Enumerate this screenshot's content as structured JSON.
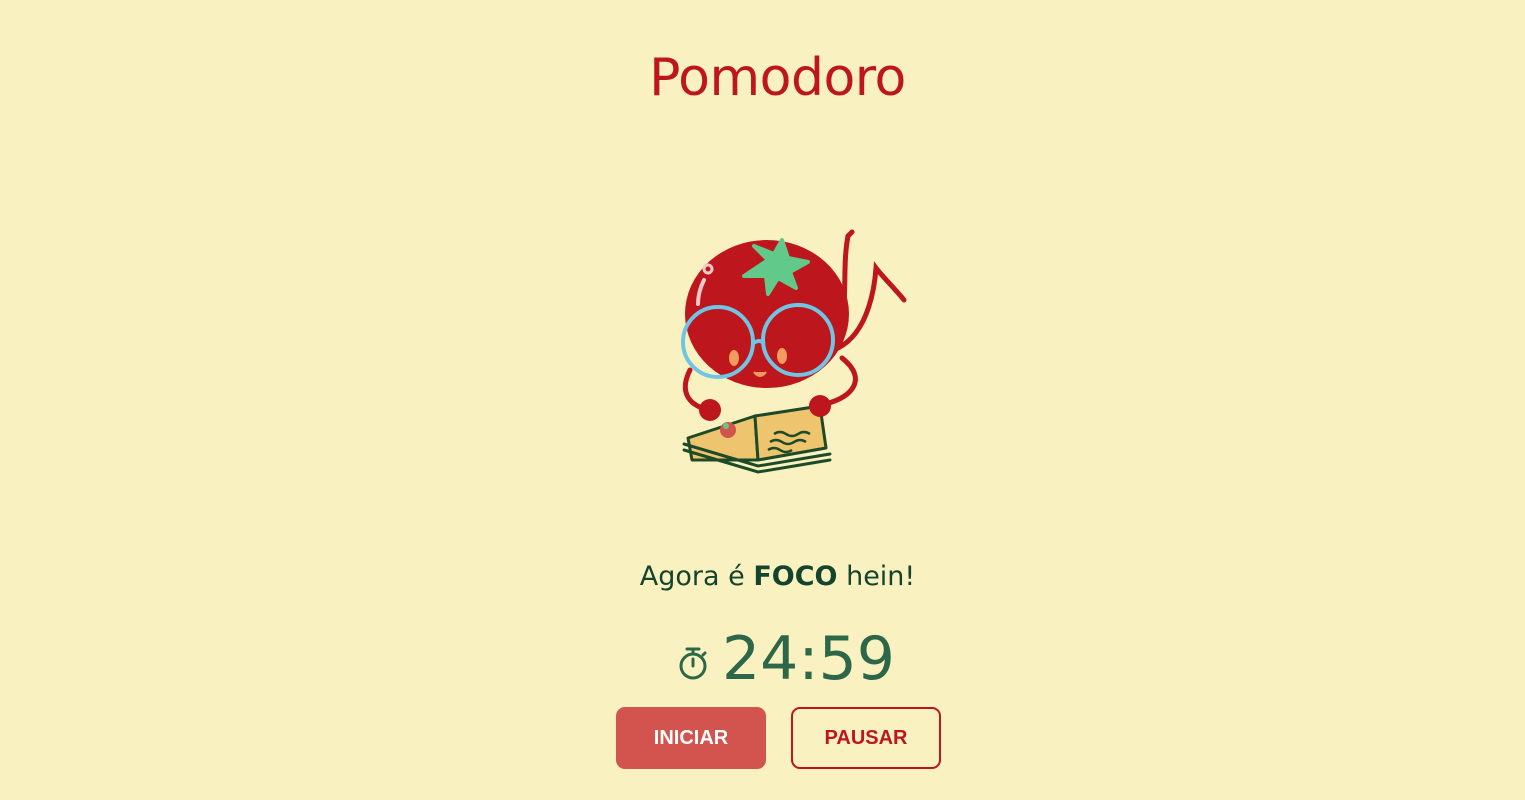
{
  "app": {
    "title": "Pomodoro"
  },
  "illustration": {
    "name": "tomato-reading-book-illustration"
  },
  "status": {
    "prefix": "Agora é",
    "emphasis": "FOCO",
    "suffix": "hein!"
  },
  "timer": {
    "icon": "stopwatch-icon",
    "value": "24:59"
  },
  "controls": {
    "start_label": "INICIAR",
    "pause_label": "PAUSAR"
  },
  "colors": {
    "background": "#faf1c1",
    "title": "#bd161d",
    "message": "#15442e",
    "timer": "#2b6748",
    "start_button": "#d3544f",
    "pause_border": "#bd161d"
  }
}
